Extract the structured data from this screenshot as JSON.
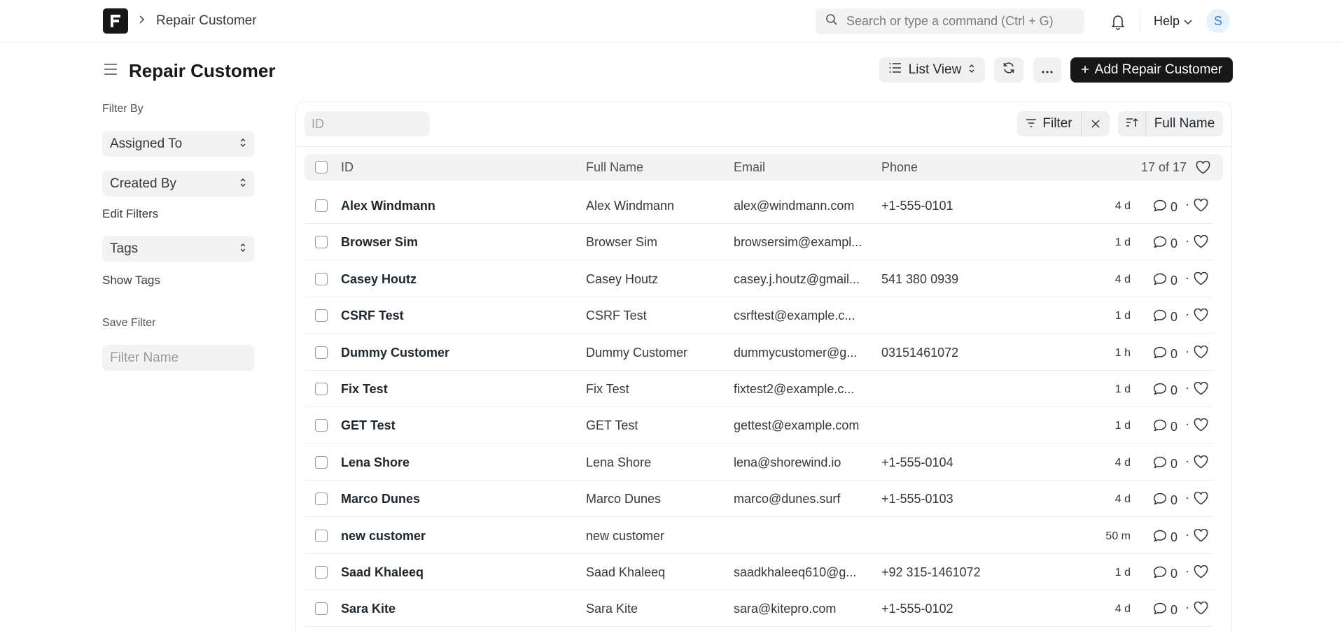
{
  "navbar": {
    "breadcrumb": "Repair Customer",
    "search_placeholder": "Search or type a command (Ctrl + G)",
    "help_label": "Help",
    "avatar_initial": "S"
  },
  "header": {
    "title": "Repair Customer",
    "view_label": "List View",
    "add_label": "Add Repair Customer"
  },
  "sidebar": {
    "filter_by_label": "Filter By",
    "assigned_to": "Assigned To",
    "created_by": "Created By",
    "edit_filters": "Edit Filters",
    "tags": "Tags",
    "show_tags": "Show Tags",
    "save_filter_label": "Save Filter",
    "filter_name_placeholder": "Filter Name"
  },
  "toolbar": {
    "id_placeholder": "ID",
    "filter_label": "Filter",
    "sort_field": "Full Name"
  },
  "table": {
    "columns": [
      "ID",
      "Full Name",
      "Email",
      "Phone"
    ],
    "count": "17 of 17",
    "rows": [
      {
        "id": "Alex Windmann",
        "full_name": "Alex Windmann",
        "email": "alex@windmann.com",
        "phone": "+1-555-0101",
        "modified": "4 d",
        "comments": "0"
      },
      {
        "id": "Browser Sim",
        "full_name": "Browser Sim",
        "email": "browsersim@exampl...",
        "phone": "",
        "modified": "1 d",
        "comments": "0"
      },
      {
        "id": "Casey Houtz",
        "full_name": "Casey Houtz",
        "email": "casey.j.houtz@gmail...",
        "phone": "541 380 0939",
        "modified": "4 d",
        "comments": "0"
      },
      {
        "id": "CSRF Test",
        "full_name": "CSRF Test",
        "email": "csrftest@example.c...",
        "phone": "",
        "modified": "1 d",
        "comments": "0"
      },
      {
        "id": "Dummy Customer",
        "full_name": "Dummy Customer",
        "email": "dummycustomer@g...",
        "phone": "03151461072",
        "modified": "1 h",
        "comments": "0"
      },
      {
        "id": "Fix Test",
        "full_name": "Fix Test",
        "email": "fixtest2@example.c...",
        "phone": "",
        "modified": "1 d",
        "comments": "0"
      },
      {
        "id": "GET Test",
        "full_name": "GET Test",
        "email": "gettest@example.com",
        "phone": "",
        "modified": "1 d",
        "comments": "0"
      },
      {
        "id": "Lena Shore",
        "full_name": "Lena Shore",
        "email": "lena@shorewind.io",
        "phone": "+1-555-0104",
        "modified": "4 d",
        "comments": "0"
      },
      {
        "id": "Marco Dunes",
        "full_name": "Marco Dunes",
        "email": "marco@dunes.surf",
        "phone": "+1-555-0103",
        "modified": "4 d",
        "comments": "0"
      },
      {
        "id": "new customer",
        "full_name": "new customer",
        "email": "",
        "phone": "",
        "modified": "50 m",
        "comments": "0"
      },
      {
        "id": "Saad Khaleeq",
        "full_name": "Saad Khaleeq",
        "email": "saadkhaleeq610@g...",
        "phone": "+92 315-1461072",
        "modified": "1 d",
        "comments": "0"
      },
      {
        "id": "Sara Kite",
        "full_name": "Sara Kite",
        "email": "sara@kitepro.com",
        "phone": "+1-555-0102",
        "modified": "4 d",
        "comments": "0"
      }
    ]
  },
  "icons": {
    "logo": "frappe-logo",
    "search": "search-icon",
    "notifications": "bell-icon",
    "menu": "hamburger-icon",
    "refresh": "refresh-icon",
    "more": "ellipsis-icon",
    "like": "heart-icon",
    "comment": "comment-icon"
  }
}
